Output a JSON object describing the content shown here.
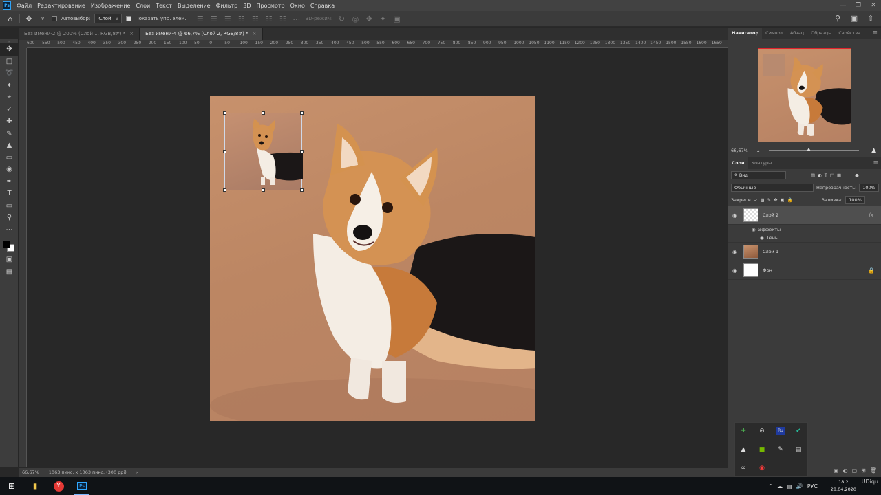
{
  "app": {
    "logo": "Ps"
  },
  "menu": [
    "Файл",
    "Редактирование",
    "Изображение",
    "Слои",
    "Текст",
    "Выделение",
    "Фильтр",
    "3D",
    "Просмотр",
    "Окно",
    "Справка"
  ],
  "options": {
    "autoselect_label": "Автовыбор:",
    "autoselect_value": "Слой",
    "show_controls_label": "Показать упр. элем.",
    "mode3d_label": "3D-режим:"
  },
  "tabs": [
    {
      "label": "Без имени-2 @ 200% (Слой 1, RGB/8#) *",
      "active": false
    },
    {
      "label": "Без имени-4 @ 66,7% (Слой 2, RGB/8#) *",
      "active": true
    }
  ],
  "ruler_top": [
    "600",
    "550",
    "500",
    "450",
    "400",
    "350",
    "300",
    "250",
    "200",
    "150",
    "100",
    "50",
    "0",
    "50",
    "100",
    "150",
    "200",
    "250",
    "300",
    "350",
    "400",
    "450",
    "500",
    "550",
    "600",
    "650",
    "700",
    "750",
    "800",
    "850",
    "900",
    "950",
    "1000",
    "1050",
    "1100",
    "1150",
    "1200",
    "1250",
    "1300",
    "1350",
    "1400",
    "1450",
    "1500",
    "1550",
    "1600",
    "1650"
  ],
  "status": {
    "zoom": "66,67%",
    "info": "1063 пикс. x 1063 пикс. (300 ppi)",
    "arrow": "›"
  },
  "navigator": {
    "tabs": [
      "Навигатор",
      "Символ",
      "Абзац",
      "Образцы",
      "Свойства"
    ],
    "zoom": "66,67%"
  },
  "layers_panel": {
    "tabs": [
      "Слои",
      "Контуры"
    ],
    "filter_kind": "Вид",
    "blend_mode": "Обычные",
    "opacity_label": "Непрозрачность:",
    "opacity_value": "100%",
    "lock_label": "Закрепить:",
    "fill_label": "Заливка:",
    "fill_value": "100%",
    "layers": [
      {
        "name": "Слой 2",
        "active": true,
        "fx": "fx",
        "effects_label": "Эффекты",
        "effect": "Тень"
      },
      {
        "name": "Слой 1",
        "active": false
      },
      {
        "name": "Фон",
        "active": false,
        "locked": true
      }
    ]
  },
  "taskbar": {
    "lang": "РУС",
    "time": "18:2",
    "date": "28.04.2020",
    "watermark": "UDiqu"
  },
  "icons": {
    "move": "move-icon",
    "home": "home-icon",
    "search": "search-icon",
    "eye": "eye-icon",
    "lock": "lock-icon"
  }
}
